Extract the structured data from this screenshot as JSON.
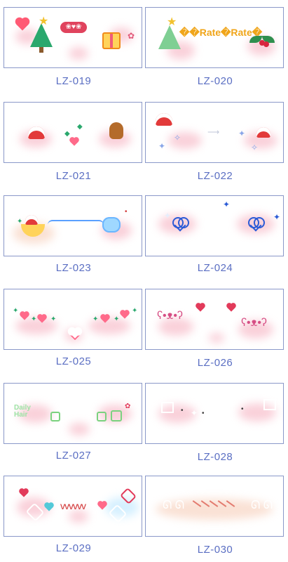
{
  "grid": {
    "items": [
      {
        "code": "LZ-019"
      },
      {
        "code": "LZ-020",
        "overlay_text": "��Rate�Rate�"
      },
      {
        "code": "LZ-021"
      },
      {
        "code": "LZ-022"
      },
      {
        "code": "LZ-023"
      },
      {
        "code": "LZ-024"
      },
      {
        "code": "LZ-025"
      },
      {
        "code": "LZ-026"
      },
      {
        "code": "LZ-027",
        "sticker_text": "Daily Hair"
      },
      {
        "code": "LZ-028"
      },
      {
        "code": "LZ-029"
      },
      {
        "code": "LZ-030"
      }
    ]
  },
  "icons": {
    "heart": "heart-icon",
    "tree": "christmas-tree-icon",
    "gift": "gift-icon",
    "santa_hat": "santa-hat-icon",
    "gingerbread": "gingerbread-icon",
    "sparkle": "sparkle-icon",
    "bunny": "bunny-icon",
    "star": "star-icon"
  },
  "colors": {
    "border": "#8a98c9",
    "code_text": "#5b6fc3",
    "blush": "#f7b8c6"
  }
}
